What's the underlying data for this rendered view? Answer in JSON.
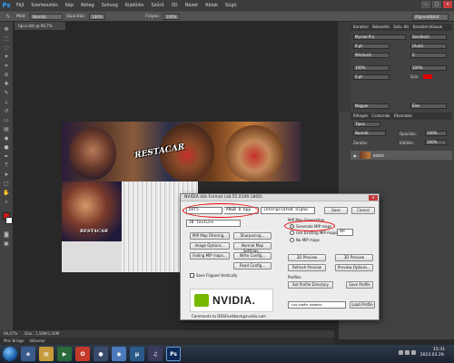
{
  "app": {
    "logo": "Ps"
  },
  "menu": [
    "Fájl",
    "Szerkesztés",
    "Kép",
    "Réteg",
    "Szöveg",
    "Kijelölés",
    "Szűrő",
    "3D",
    "Nézet",
    "Ablak",
    "Súgó"
  ],
  "options": {
    "mode_label": "Mód:",
    "mode_value": "Normál",
    "opacity_label": "Opacitás:",
    "opacity_value": "100%",
    "flow_label": "Folyás:",
    "flow_value": "100%",
    "workspace": "Alapvetőként"
  },
  "document_tab": "tipus.dds @ 66,7% (RGB/8)",
  "canvas": {
    "logo_text": "RESTACAR",
    "logo_text_small": "RESTACAR"
  },
  "status": {
    "zoom": "66,67%",
    "doc_info": "Dok.: 1,56M/1,56M"
  },
  "minibridge": {
    "tab1": "Mini Bridge",
    "tab2": "Idővonal"
  },
  "right_panel": {
    "tabs_top": [
      "Karakter",
      "Bekezdés",
      "Szöv. Ktr",
      "Karakterstílusok"
    ],
    "font": "Myriad Pro",
    "font_style": "Semibold",
    "size": "6 pt",
    "leading": "(Auto)",
    "kerning": "Mérőszál",
    "tracking": "0",
    "scale_v": "100%",
    "scale_h": "100%",
    "baseline": "0 pt",
    "color_label": "Szín:",
    "language": "Magyar",
    "antialias": "Éles",
    "tabs_layers": [
      "Rétegek",
      "Csatornák",
      "Útvonalak"
    ],
    "kind_label": "Típus",
    "blend": "Normál",
    "opacity_label": "Opacitás:",
    "opacity": "100%",
    "lock_label": "Zárolás:",
    "fill_label": "Kitöltés:",
    "fill": "100%",
    "layer_name": "Háttér"
  },
  "dialog": {
    "title": "NVIDIA dds Format (v8.55.0109.1800)",
    "close": "✕",
    "format": "DXT5",
    "format_desc": "ARGB   8 bpp",
    "alpha": "interpolated alpha",
    "save": "Save",
    "cancel": "Cancel",
    "texture_type": "2D Texture",
    "mip_header": "MIP Map Generation",
    "generate_mip": "Generate MIP maps",
    "use_existing_mip": "Use Existing MIP maps",
    "mip_count": "All",
    "no_mip": "No MIP maps",
    "mip_filtering": "MIP Map Filtering...",
    "sharpening": "Sharpening...",
    "image_options": "Image Options...",
    "normal_map": "Normal Map Settings...",
    "fading_mip": "Fading MIP maps...",
    "write_config": "Write Config...",
    "read_config": "Read Config...",
    "preview_2d": "2D Preview",
    "preview_3d": "3D Preview",
    "refresh_preview": "Refresh Preview",
    "preview_options": "Preview Options...",
    "save_flipped": "Save Flipped Vertically",
    "profiles": "Profiles",
    "set_profile_dir": "Set Profile Directory",
    "save_profile": "Save Profile",
    "no_profile": "<no profile loaded>",
    "load_profile": "Load Profile",
    "comments": "Comments to DDSFeedback@nvidia.com",
    "nvidia_logo": "NVIDIA."
  },
  "taskbar": {
    "clock_time": "15:31",
    "clock_date": "2013.03.29."
  },
  "colors": {
    "accent_red": "#e00000",
    "nvidia_green": "#76b900",
    "fg_swatch": "#cc1a1a",
    "bg_swatch": "#ffffff"
  }
}
